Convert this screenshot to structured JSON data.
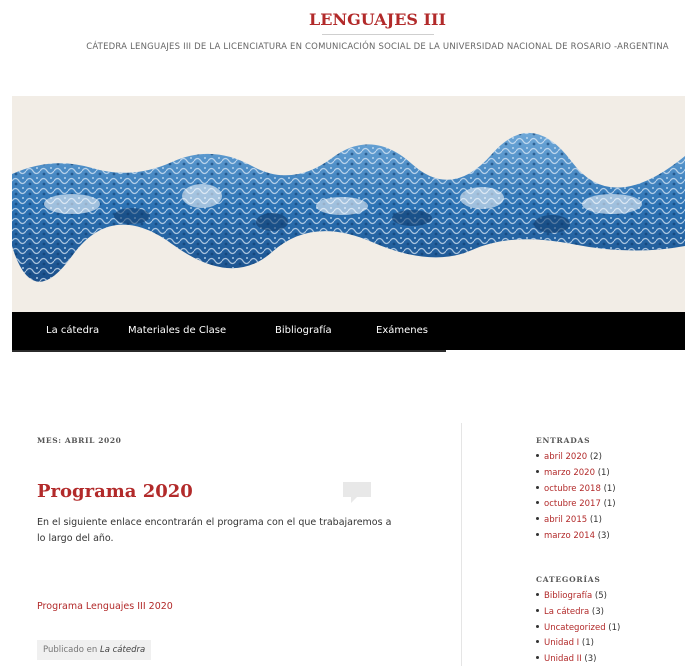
{
  "header": {
    "site_title": "LENGUAJES III",
    "site_description": "CÁTEDRA LENGUAJES III DE LA LICENCIATURA EN COMUNICACIÓN SOCIAL DE LA UNIVERSIDAD NACIONAL DE ROSARIO -ARGENTINA"
  },
  "nav": {
    "items": [
      {
        "label": "La cátedra"
      },
      {
        "label": "Materiales de Clase"
      },
      {
        "label": "Bibliografía"
      },
      {
        "label": "Exámenes"
      }
    ]
  },
  "archive": {
    "title": "MES: ABRIL 2020"
  },
  "post": {
    "title": "Programa 2020",
    "body": "En el siguiente enlace encontrarán el programa con el que trabajaremos a lo largo del año.",
    "link_text": "Programa Lenguajes III 2020",
    "posted_in_prefix": "Publicado en",
    "posted_in_category": "La cátedra"
  },
  "sidebar": {
    "entradas_title": "ENTRADAS",
    "entradas": [
      {
        "label": "abril 2020",
        "count": "(2)"
      },
      {
        "label": "marzo 2020",
        "count": "(1)"
      },
      {
        "label": "octubre 2018",
        "count": "(1)"
      },
      {
        "label": "octubre 2017",
        "count": "(1)"
      },
      {
        "label": "abril 2015",
        "count": "(1)"
      },
      {
        "label": "marzo 2014",
        "count": "(3)"
      }
    ],
    "categorias_title": "CATEGORÍAS",
    "categorias": [
      {
        "label": "Bibliografía",
        "count": "(5)"
      },
      {
        "label": "La cátedra",
        "count": "(3)"
      },
      {
        "label": "Uncategorized",
        "count": "(1)"
      },
      {
        "label": "Unidad I",
        "count": "(1)"
      },
      {
        "label": "Unidad II",
        "count": "(3)"
      }
    ]
  },
  "colors": {
    "accent": "#b22a2a",
    "nav_bg": "#000000",
    "banner_bg": "#f2ede6",
    "banner_blue": "#2b72b4"
  },
  "icons": {
    "comment": "comment-bubble-icon",
    "bullet": "bullet-icon"
  }
}
